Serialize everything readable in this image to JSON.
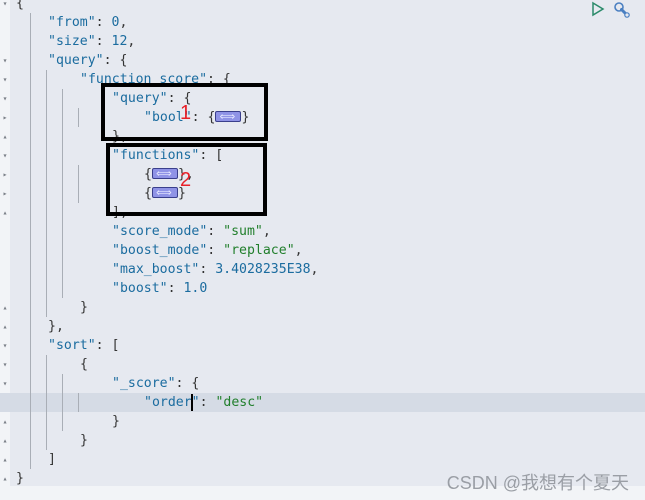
{
  "toolbar": {
    "play_icon": "play-icon",
    "wrench_icon": "wrench-icon"
  },
  "code": {
    "lines": [
      {
        "fold": "down",
        "text": "{"
      },
      {
        "fold": "",
        "key": "\"from\"",
        "num": "0",
        "suffix": ","
      },
      {
        "fold": "",
        "key": "\"size\"",
        "num": "12",
        "suffix": ","
      },
      {
        "fold": "down",
        "key": "\"query\"",
        "suffix": ": {"
      },
      {
        "fold": "down",
        "key": "\"function_score\"",
        "suffix": ": {"
      },
      {
        "fold": "down",
        "key": "\"query\"",
        "suffix": ": {"
      },
      {
        "fold": "right",
        "key": "\"bool\"",
        "suffix": ": {",
        "collapsed": true,
        "after": "}"
      },
      {
        "fold": "up",
        "text": "},"
      },
      {
        "fold": "down",
        "key": "\"functions\"",
        "suffix": ": ["
      },
      {
        "fold": "right",
        "text": "{",
        "collapsed": true,
        "after": "},"
      },
      {
        "fold": "right",
        "text": "{",
        "collapsed": true,
        "after": "}"
      },
      {
        "fold": "up",
        "text": "],"
      },
      {
        "fold": "",
        "key": "\"score_mode\"",
        "str": "\"sum\"",
        "suffix": ","
      },
      {
        "fold": "",
        "key": "\"boost_mode\"",
        "str": "\"replace\"",
        "suffix": ","
      },
      {
        "fold": "",
        "key": "\"max_boost\"",
        "num": "3.4028235E38",
        "suffix": ","
      },
      {
        "fold": "",
        "key": "\"boost\"",
        "num": "1.0",
        "suffix": ""
      },
      {
        "fold": "up",
        "text": "}"
      },
      {
        "fold": "up",
        "text": "},"
      },
      {
        "fold": "down",
        "key": "\"sort\"",
        "suffix": ": ["
      },
      {
        "fold": "down",
        "text": "{"
      },
      {
        "fold": "down",
        "key": "\"_score\"",
        "suffix": ": {"
      },
      {
        "fold": "",
        "key": "\"order\"",
        "str": "\"desc\"",
        "suffix": "",
        "active": true
      },
      {
        "fold": "up",
        "text": "}"
      },
      {
        "fold": "up",
        "text": "}"
      },
      {
        "fold": "up",
        "text": "]"
      },
      {
        "fold": "up",
        "text": "}"
      }
    ]
  },
  "annotations": {
    "label_1": "1",
    "label_2": "2"
  },
  "watermark": "CSDN @我想有个夏天",
  "colors": {
    "key": "#1b6c9f",
    "string": "#217f2c",
    "annotation": "#e8222a",
    "editor_bg": "#e6e9f0"
  }
}
